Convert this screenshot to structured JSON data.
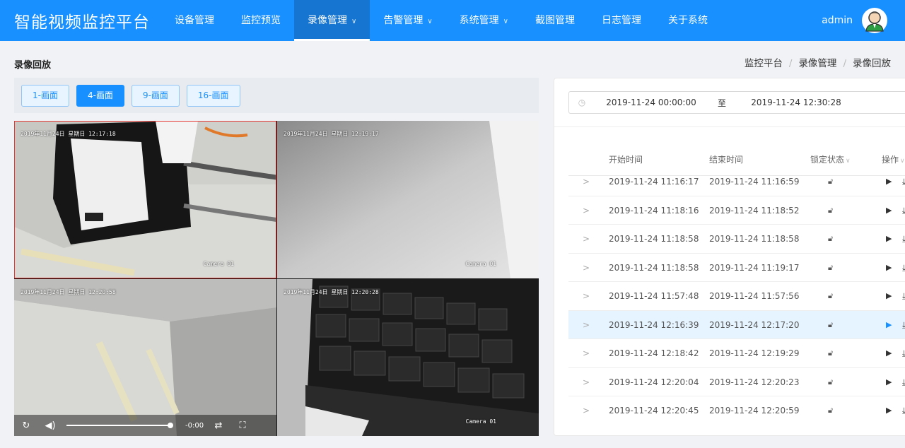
{
  "app": {
    "title": "智能视频监控平台"
  },
  "nav": [
    {
      "label": "设备管理",
      "active": false,
      "dropdown": false
    },
    {
      "label": "监控预览",
      "active": false,
      "dropdown": false
    },
    {
      "label": "录像管理",
      "active": true,
      "dropdown": true
    },
    {
      "label": "告警管理",
      "active": false,
      "dropdown": true
    },
    {
      "label": "系统管理",
      "active": false,
      "dropdown": true
    },
    {
      "label": "截图管理",
      "active": false,
      "dropdown": false
    },
    {
      "label": "日志管理",
      "active": false,
      "dropdown": false
    },
    {
      "label": "关于系统",
      "active": false,
      "dropdown": false
    }
  ],
  "user": {
    "name": "admin",
    "avatar_icon": "user-avatar-icon"
  },
  "page": {
    "title": "录像回放"
  },
  "breadcrumb": [
    "监控平台",
    "录像管理",
    "录像回放"
  ],
  "layout_buttons": [
    {
      "label": "1-画面",
      "active": false
    },
    {
      "label": "4-画面",
      "active": true
    },
    {
      "label": "9-画面",
      "active": false
    },
    {
      "label": "16-画面",
      "active": false
    }
  ],
  "cameras": [
    {
      "osd": "2019年11月24日 星期日 12:17:18",
      "name": "Camera 01",
      "selected": true
    },
    {
      "osd": "2019年11月24日 星期日 12:19:17",
      "name": "Camera 01",
      "selected": false
    },
    {
      "osd": "2019年11月24日 星期日 12:20:58",
      "name": "",
      "selected": false
    },
    {
      "osd": "2019年11月24日 星期日 12:20:28",
      "name": "Camera 01",
      "selected": false
    }
  ],
  "player": {
    "time": "-0:00",
    "icons": [
      "replay-icon",
      "volume-icon",
      "switch-icon",
      "fullscreen-icon"
    ]
  },
  "range": {
    "start": "2019-11-24 00:00:00",
    "separator": "至",
    "end": "2019-11-24 12:30:28"
  },
  "table": {
    "headers": {
      "start": "开始时间",
      "end": "结束时间",
      "lock": "锁定状态",
      "ops": "操作"
    },
    "rows": [
      {
        "start": "2019-11-24 11:16:17",
        "end": "2019-11-24 11:16:59",
        "highlight": false
      },
      {
        "start": "2019-11-24 11:18:16",
        "end": "2019-11-24 11:18:52",
        "highlight": false
      },
      {
        "start": "2019-11-24 11:18:58",
        "end": "2019-11-24 11:18:58",
        "highlight": false
      },
      {
        "start": "2019-11-24 11:18:58",
        "end": "2019-11-24 11:19:17",
        "highlight": false
      },
      {
        "start": "2019-11-24 11:57:48",
        "end": "2019-11-24 11:57:56",
        "highlight": false
      },
      {
        "start": "2019-11-24 12:16:39",
        "end": "2019-11-24 12:17:20",
        "highlight": true
      },
      {
        "start": "2019-11-24 12:18:42",
        "end": "2019-11-24 12:19:29",
        "highlight": false
      },
      {
        "start": "2019-11-24 12:20:04",
        "end": "2019-11-24 12:20:23",
        "highlight": false
      },
      {
        "start": "2019-11-24 12:20:45",
        "end": "2019-11-24 12:20:59",
        "highlight": false
      }
    ]
  },
  "colors": {
    "brand": "#1890ff",
    "selected_border": "#e53935",
    "row_highlight": "#e6f4ff"
  }
}
